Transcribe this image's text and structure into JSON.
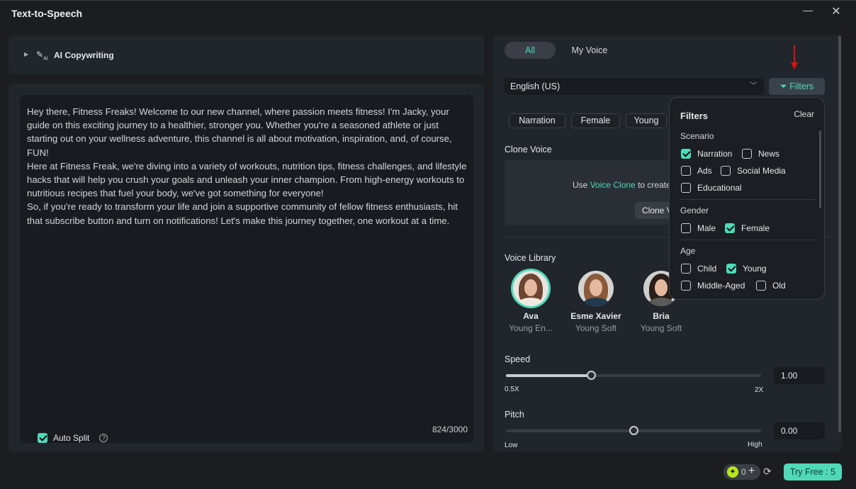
{
  "window": {
    "title": "Text-to-Speech",
    "minimize": "—",
    "close": "✕"
  },
  "copywriting": {
    "label": "AI Copywriting",
    "icon": "pencil-ai-icon"
  },
  "editor": {
    "paragraphs": [
      "Hey there, Fitness Freaks! Welcome to our new channel, where passion meets fitness! I'm Jacky, your guide on this exciting journey to a healthier, stronger you. Whether you're a seasoned athlete or just starting out on your wellness adventure, this channel is all about motivation, inspiration, and, of course, FUN!",
      "Here at Fitness Freak, we're diving into a variety of workouts, nutrition tips, fitness challenges, and lifestyle hacks that will help you crush your goals and unleash your inner champion. From high-energy workouts to nutritious recipes that fuel your body, we've got something for everyone!",
      "So, if you're ready to transform your life and join a supportive community of fellow fitness enthusiasts, hit that subscribe button and turn on notifications! Let's make this journey together, one workout at a time."
    ],
    "auto_split_label": "Auto Split",
    "auto_split_checked": true,
    "char_count": "824/3000"
  },
  "voice_panel": {
    "tabs": [
      {
        "label": "All",
        "active": true
      },
      {
        "label": "My Voice",
        "active": false
      }
    ],
    "language": "English (US)",
    "filters_label": "Filters",
    "chips": [
      "Narration",
      "Female",
      "Young"
    ],
    "clone": {
      "heading": "Clone Voice",
      "text_pre": "Use ",
      "link": "Voice Clone",
      "text_post": " to create",
      "button": "Clone Voice"
    },
    "library_heading": "Voice Library",
    "voices": [
      {
        "name": "Ava",
        "desc": "Young En...",
        "selected": true
      },
      {
        "name": "Esme Xavier",
        "desc": "Young Soft",
        "selected": false
      },
      {
        "name": "Bria",
        "desc": "Young Soft",
        "selected": false
      }
    ],
    "speed": {
      "label": "Speed",
      "value": "1.00",
      "min_label": "0.5X",
      "max_label": "2X",
      "level": 1.0,
      "min": 0.5,
      "max": 2
    },
    "pitch": {
      "label": "Pitch",
      "value": "0.00",
      "min_label": "Low",
      "max_label": "High",
      "level": 0.5
    }
  },
  "filters_popup": {
    "title": "Filters",
    "clear": "Clear",
    "scenario": {
      "label": "Scenario",
      "options": [
        {
          "label": "Narration",
          "checked": true
        },
        {
          "label": "News",
          "checked": false
        },
        {
          "label": "Ads",
          "checked": false
        },
        {
          "label": "Social Media",
          "checked": false
        },
        {
          "label": "Educational",
          "checked": false
        }
      ]
    },
    "gender": {
      "label": "Gender",
      "options": [
        {
          "label": "Male",
          "checked": false
        },
        {
          "label": "Female",
          "checked": true
        }
      ]
    },
    "age": {
      "label": "Age",
      "options": [
        {
          "label": "Child",
          "checked": false
        },
        {
          "label": "Young",
          "checked": true
        },
        {
          "label": "Middle-Aged",
          "checked": false
        },
        {
          "label": "Old",
          "checked": false
        }
      ]
    }
  },
  "footer": {
    "credits": "0",
    "try_free": "Try Free : 5"
  },
  "colors": {
    "accent": "#4fd9b8",
    "background": "#1b1d20",
    "panel": "#21262c",
    "annotation_arrow": "#e01010"
  }
}
